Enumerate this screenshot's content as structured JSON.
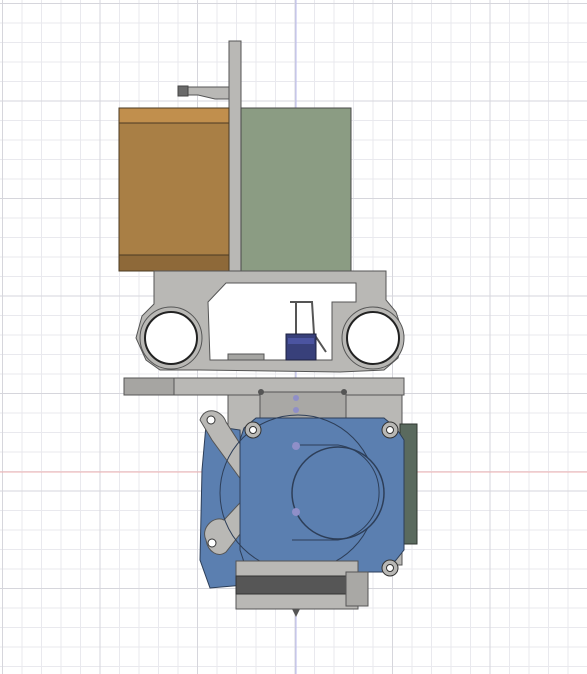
{
  "viewport": {
    "view": "front",
    "background": "#ffffff",
    "grid_minor_color": "#e9e9ee",
    "grid_major_color": "#d6d6dc",
    "axis_vertical_color": "#a7a7e8",
    "axis_horizontal_color": "#e8a7a7"
  },
  "model": {
    "frame_color": "#b9b8b5",
    "stepper_color": "#a97f45",
    "gray_block_color": "#8b9c83",
    "fan_color": "#5b7fb0",
    "board_color": "#5a6a5e",
    "motor_color": "#38407a"
  }
}
